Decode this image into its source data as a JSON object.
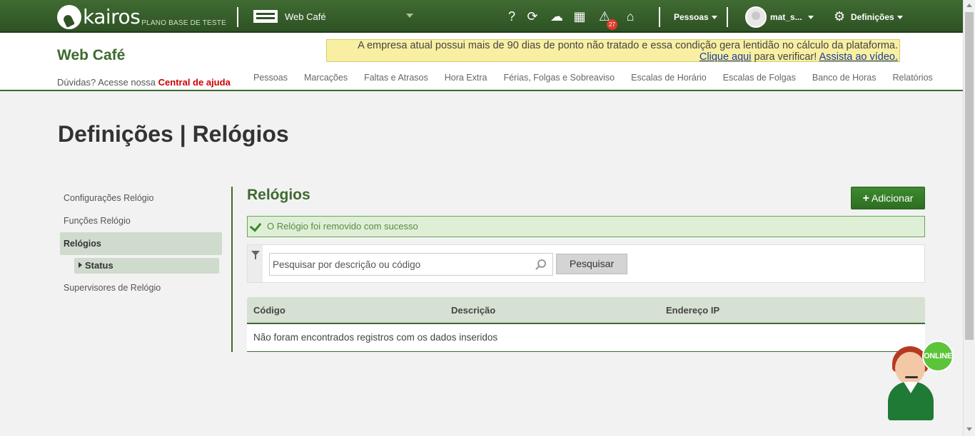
{
  "topbar": {
    "logo_text": "kairos",
    "plan_text": "PLANO BASE DE TESTE",
    "company": "Web Café",
    "icons": [
      "help-icon",
      "sync-icon",
      "cloud-upload-icon",
      "calculator-icon",
      "alert-icon",
      "inbox-icon"
    ],
    "alert_count": "27",
    "people_menu": "Pessoas",
    "username": "mat_s...",
    "settings_menu": "Definições"
  },
  "header": {
    "brand": "Web Café",
    "help_text": "Dúvidas? Acesse nossa",
    "help_link": "Central de ajuda",
    "warning_text": "A empresa atual possui mais de 90 dias de ponto não tratado e essa condição gera lentidão no cálculo da plataforma.",
    "warning_link1": "Clique aqui",
    "warning_mid": "para verificar!",
    "warning_link2": "Assista ao vídeo.",
    "nav": [
      "Pessoas",
      "Marcações",
      "Faltas e Atrasos",
      "Hora Extra",
      "Férias, Folgas e Sobreaviso",
      "Escalas de Horário",
      "Escalas de Folgas",
      "Banco de Horas",
      "Relatórios"
    ]
  },
  "page_title": "Definições | Relógios",
  "sidebar": {
    "items": [
      "Configurações Relógio",
      "Funções Relógio",
      "Relógios",
      "Supervisores de Relógio"
    ],
    "sub_item": "Status"
  },
  "content": {
    "title": "Relógios",
    "add_button": "Adicionar",
    "success_message": "O Relógio foi removido com sucesso",
    "search_placeholder": "Pesquisar por descrição ou código",
    "search_button": "Pesquisar",
    "columns": [
      "Código",
      "Descrição",
      "Endereço IP"
    ],
    "empty_message": "Não foram encontrados registros com os dados inseridos"
  },
  "chat": {
    "status": "ONLINE"
  },
  "colors": {
    "brand_green": "#3d6a2f",
    "button_green": "#2d6e22",
    "alert_red": "#e03b2c",
    "link_red": "#cc0000"
  }
}
